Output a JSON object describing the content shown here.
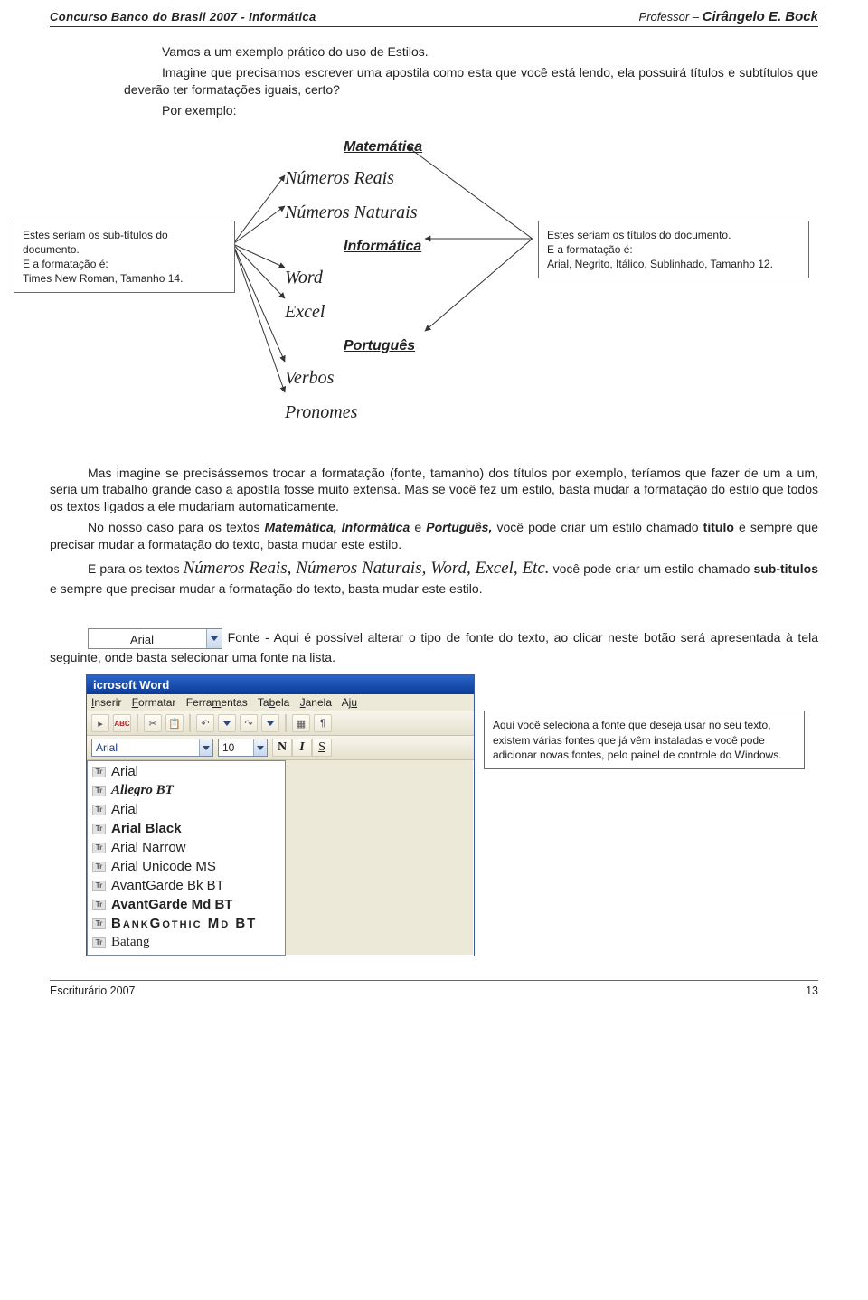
{
  "header": {
    "left": "Concurso Banco do Brasil 2007 - Informática",
    "right_label": "Professor – ",
    "right_name": "Cirângelo E. Bock"
  },
  "intro": {
    "p1": "Vamos a um exemplo prático do uso de Estilos.",
    "p2": "Imagine que precisamos escrever uma apostila como esta que você está lendo, ela possuirá títulos e subtítulos que deverão ter formatações iguais, certo?",
    "p3": "Por exemplo:"
  },
  "outline": {
    "t1": "Matemática",
    "s1": "Números Reais",
    "s2": "Números Naturais",
    "t2": "Informática",
    "s3": "Word",
    "s4": "Excel",
    "t3": "Português",
    "s5": "Verbos",
    "s6": "Pronomes"
  },
  "left_note": {
    "l1": "Estes seriam os sub-títulos do documento.",
    "l2": "E a formatação é:",
    "l3": "Times New Roman, Tamanho 14."
  },
  "right_note": {
    "l1": "Estes seriam os títulos do documento.",
    "l2": "E a formatação é:",
    "l3": "Arial, Negrito, Itálico, Sublinhado, Tamanho 12."
  },
  "para_block": {
    "p1": "Mas imagine se precisássemos trocar a formatação (fonte, tamanho) dos títulos por exemplo, teríamos que fazer de um a um, seria um trabalho grande caso a apostila fosse muito extensa. Mas se você fez um estilo, basta mudar a formatação do estilo que todos os textos ligados a ele mudariam automaticamente.",
    "p2a": "No nosso caso para os textos ",
    "p2b": "Matemática, Informática",
    "p2c": " e ",
    "p2d": "Português,",
    "p2e": " você pode criar um estilo chamado ",
    "p2f": "titulo",
    "p2g": " e sempre que precisar mudar a formatação do texto, basta mudar este estilo.",
    "p3a": "E para os textos ",
    "p3b": "Números Reais, Números Naturais, Word, Excel, Etc.",
    "p3c": " você pode criar um estilo chamado ",
    "p3d": "sub-titulos",
    "p3e": " e sempre que precisar mudar a formatação do texto, basta mudar este estilo."
  },
  "font_combo_value": "Arial",
  "font_paragraph": " Fonte - Aqui é possível alterar o tipo de fonte do texto, ao clicar neste botão será apresentada à tela seguinte, onde basta selecionar uma fonte na lista.",
  "word": {
    "title": "icrosoft Word",
    "menu": {
      "m1": "Inserir",
      "m2": "Formatar",
      "m3": "Ferramentas",
      "m4": "Tabela",
      "m5": "Janela",
      "m6": "Aju"
    },
    "font_field": "Arial",
    "size_field": "10",
    "btn_bold": "N",
    "btn_italic": "I",
    "btn_under": "S",
    "fonts": [
      {
        "name": "Arial",
        "style": "font-family:Arial"
      },
      {
        "name": "Allegro BT",
        "style": "font-family:'Brush Script MT',cursive; font-weight:bold; font-style:italic"
      },
      {
        "name": "Arial",
        "style": "font-family:Arial"
      },
      {
        "name": "Arial Black",
        "style": "font-family:'Arial Black',Arial; font-weight:900"
      },
      {
        "name": "Arial Narrow",
        "style": "font-family:'Arial Narrow',Arial; font-stretch:condensed"
      },
      {
        "name": "Arial Unicode MS",
        "style": "font-family:Arial"
      },
      {
        "name": "AvantGarde Bk BT",
        "style": "font-family:Arial"
      },
      {
        "name": "AvantGarde Md BT",
        "style": "font-family:Arial; font-weight:bold"
      },
      {
        "name": "BankGothic Md BT",
        "style": "font-family:Arial; font-variant:small-caps; letter-spacing:2px; font-weight:bold"
      },
      {
        "name": "Batang",
        "style": "font-family:serif"
      }
    ]
  },
  "word_note": "Aqui você seleciona a fonte que deseja usar no seu texto, existem várias fontes que já vêm instaladas e você pode adicionar novas fontes, pelo painel de controle do Windows.",
  "footer": {
    "left": "Escriturário 2007",
    "right": "13"
  }
}
